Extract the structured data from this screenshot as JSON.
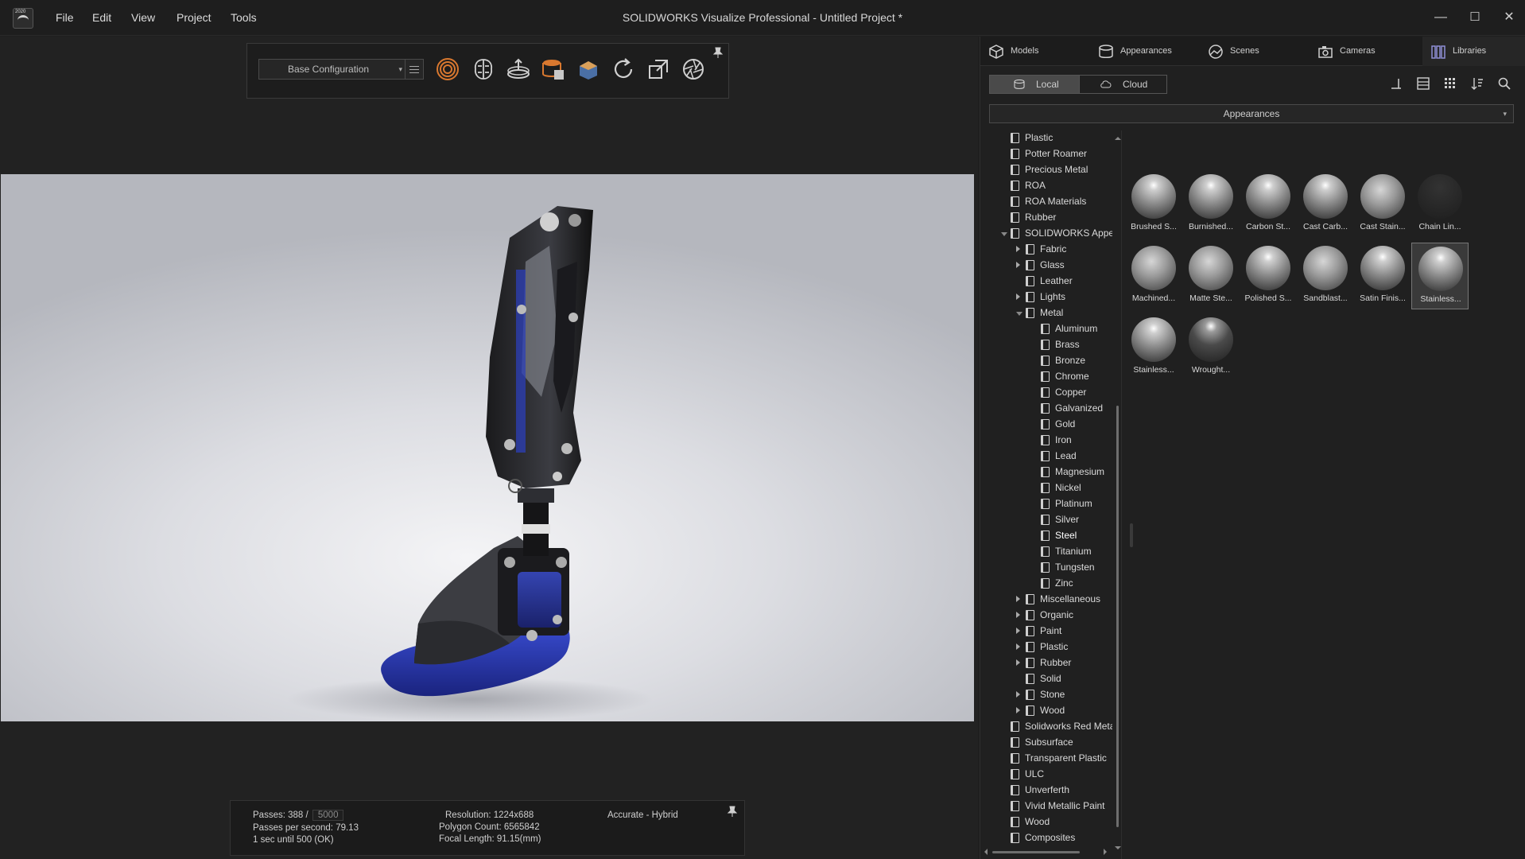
{
  "titlebar": {
    "logo_year": "2020",
    "menu": [
      "File",
      "Edit",
      "View",
      "Project",
      "Tools"
    ],
    "title": "SOLIDWORKS Visualize Professional - Untitled Project *",
    "win_min": "—",
    "win_max": "☐",
    "win_close": "✕"
  },
  "toolbar": {
    "configuration": "Base Configuration",
    "chevron": "▾"
  },
  "stats": {
    "passes_label": "Passes: 388 /",
    "passes_total": "5000",
    "passes_per_second": "Passes per second: 79.13",
    "time_until": "1 sec until 500 (OK)",
    "resolution": "Resolution: 1224x688",
    "polygon_count": "Polygon Count: 6565842",
    "focal_length": "Focal Length: 91.15(mm)",
    "render_mode": "Accurate - Hybrid"
  },
  "right_panel": {
    "tabs": [
      "Models",
      "Appearances",
      "Scenes",
      "Cameras",
      "Libraries"
    ],
    "source": {
      "local": "Local",
      "cloud": "Cloud"
    },
    "library": "Appearances",
    "tree": [
      {
        "label": "Plastic",
        "level": 0,
        "arrow": "none"
      },
      {
        "label": "Potter Roamer",
        "level": 0,
        "arrow": "none"
      },
      {
        "label": "Precious Metal",
        "level": 0,
        "arrow": "none"
      },
      {
        "label": "ROA",
        "level": 0,
        "arrow": "none"
      },
      {
        "label": "ROA Materials",
        "level": 0,
        "arrow": "none"
      },
      {
        "label": "Rubber",
        "level": 0,
        "arrow": "none"
      },
      {
        "label": "SOLIDWORKS Appearances",
        "level": 0,
        "arrow": "open"
      },
      {
        "label": "Fabric",
        "level": 1,
        "arrow": "closed"
      },
      {
        "label": "Glass",
        "level": 1,
        "arrow": "closed"
      },
      {
        "label": "Leather",
        "level": 1,
        "arrow": "none"
      },
      {
        "label": "Lights",
        "level": 1,
        "arrow": "closed"
      },
      {
        "label": "Metal",
        "level": 1,
        "arrow": "open"
      },
      {
        "label": "Aluminum",
        "level": 2,
        "arrow": "none"
      },
      {
        "label": "Brass",
        "level": 2,
        "arrow": "none"
      },
      {
        "label": "Bronze",
        "level": 2,
        "arrow": "none"
      },
      {
        "label": "Chrome",
        "level": 2,
        "arrow": "none"
      },
      {
        "label": "Copper",
        "level": 2,
        "arrow": "none"
      },
      {
        "label": "Galvanized",
        "level": 2,
        "arrow": "none"
      },
      {
        "label": "Gold",
        "level": 2,
        "arrow": "none"
      },
      {
        "label": "Iron",
        "level": 2,
        "arrow": "none"
      },
      {
        "label": "Lead",
        "level": 2,
        "arrow": "none"
      },
      {
        "label": "Magnesium",
        "level": 2,
        "arrow": "none"
      },
      {
        "label": "Nickel",
        "level": 2,
        "arrow": "none"
      },
      {
        "label": "Platinum",
        "level": 2,
        "arrow": "none"
      },
      {
        "label": "Silver",
        "level": 2,
        "arrow": "none"
      },
      {
        "label": "Steel",
        "level": 2,
        "arrow": "none",
        "selected": true
      },
      {
        "label": "Titanium",
        "level": 2,
        "arrow": "none"
      },
      {
        "label": "Tungsten",
        "level": 2,
        "arrow": "none"
      },
      {
        "label": "Zinc",
        "level": 2,
        "arrow": "none"
      },
      {
        "label": "Miscellaneous",
        "level": 1,
        "arrow": "closed"
      },
      {
        "label": "Organic",
        "level": 1,
        "arrow": "closed"
      },
      {
        "label": "Paint",
        "level": 1,
        "arrow": "closed"
      },
      {
        "label": "Plastic",
        "level": 1,
        "arrow": "closed"
      },
      {
        "label": "Rubber",
        "level": 1,
        "arrow": "closed"
      },
      {
        "label": "Solid",
        "level": 1,
        "arrow": "none"
      },
      {
        "label": "Stone",
        "level": 1,
        "arrow": "closed"
      },
      {
        "label": "Wood",
        "level": 1,
        "arrow": "closed"
      },
      {
        "label": "Solidworks Red Metal",
        "level": 0,
        "arrow": "none"
      },
      {
        "label": "Subsurface",
        "level": 0,
        "arrow": "none"
      },
      {
        "label": "Transparent Plastic",
        "level": 0,
        "arrow": "none"
      },
      {
        "label": "ULC",
        "level": 0,
        "arrow": "none"
      },
      {
        "label": "Unverferth",
        "level": 0,
        "arrow": "none"
      },
      {
        "label": "Vivid Metallic Paint",
        "level": 0,
        "arrow": "none"
      },
      {
        "label": "Wood",
        "level": 0,
        "arrow": "none"
      },
      {
        "label": "Composites",
        "level": 0,
        "arrow": "none"
      }
    ],
    "thumbnails": [
      {
        "label": "Brushed S...",
        "style": ""
      },
      {
        "label": "Burnished...",
        "style": ""
      },
      {
        "label": "Carbon St...",
        "style": ""
      },
      {
        "label": "Cast Carb...",
        "style": ""
      },
      {
        "label": "Cast Stain...",
        "style": "matte"
      },
      {
        "label": "Chain Lin...",
        "style": "dark"
      },
      {
        "label": "Machined...",
        "style": "matte"
      },
      {
        "label": "Matte Ste...",
        "style": "matte"
      },
      {
        "label": "Polished S...",
        "style": ""
      },
      {
        "label": "Sandblast...",
        "style": "matte"
      },
      {
        "label": "Satin Finis...",
        "style": ""
      },
      {
        "label": "Stainless...",
        "style": "",
        "selected": true
      },
      {
        "label": "Stainless...",
        "style": ""
      },
      {
        "label": "Wrought...",
        "style": "ww"
      }
    ]
  }
}
